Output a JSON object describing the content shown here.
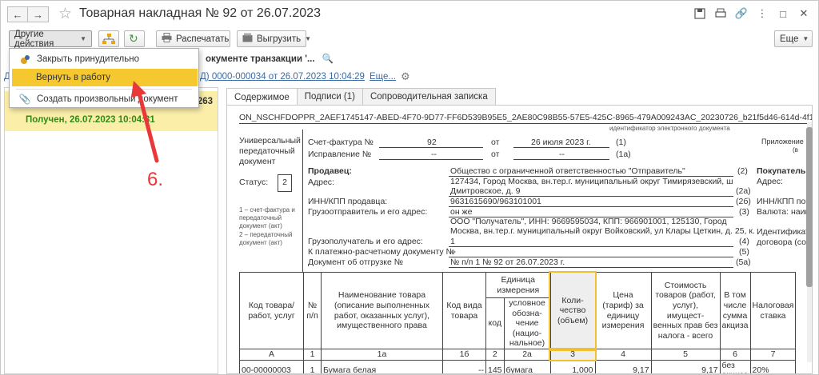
{
  "window": {
    "title": "Товарная накладная № 92 от 26.07.2023"
  },
  "toolbar": {
    "other_actions": "Другие действия",
    "print": "Распечатать",
    "export": "Выгрузить",
    "more": "Еще"
  },
  "menu": {
    "items": [
      {
        "label": "Закрыть принудительно",
        "icon": "force-close-icon"
      },
      {
        "label": "Вернуть в работу",
        "icon": "",
        "highlighted": true
      },
      {
        "label": "Создать произвольный документ",
        "icon": "paperclip-icon"
      }
    ]
  },
  "info": {
    "transaction_line": "окументе транзакции '...",
    "doc_link": "Д) 0000-000034 от 26.07.2023 10:04:29",
    "more_link": "Еще...",
    "left_fragment": "Д"
  },
  "left_panel": {
    "number_fragment": "263",
    "status": "Получен, 26.07.2023 10:04:31"
  },
  "tabs": [
    {
      "label": "Содержимое",
      "active": true
    },
    {
      "label": "Подписи (1)",
      "active": false
    },
    {
      "label": "Сопроводительная записка",
      "active": false
    }
  ],
  "document": {
    "file_id": "ON_NSCHFDOPPR_2AEF1745147-ABED-4F70-9D77-FF6D539B95E5_2AE80C98B55-57E5-425C-8965-479A009243AC_20230726_b21f5d46-614d-4f18-9c9d-(",
    "file_id_caption": "идентификатор электронного документа",
    "upd_title": "Универсальный передаточный документ",
    "status_label": "Статус:",
    "status_value": "2",
    "status_note_1": "1 – счет-фактура и передаточный документ (акт)",
    "status_note_2": "2 – передаточный документ (акт)",
    "invoice_label": "Счет-фактура №",
    "invoice_no": "92",
    "from_word": "от",
    "invoice_date": "26 июля 2023 г.",
    "invoice_ref": "(1)",
    "correction_label": "Исправление №",
    "correction_no": "--",
    "correction_from": "от",
    "correction_date": "--",
    "correction_ref": "(1а)",
    "appendix": "Приложение",
    "appendix_sub": "(в",
    "seller_label": "Продавец:",
    "seller_value": "Общество с ограниченной ответственностью \"Отправитель\"",
    "seller_ref": "(2)",
    "buyer_label": "Покупатель:",
    "address_label": "Адрес:",
    "address_value_1": "127434, Город Москва, вн.тер.г. муниципальный округ Тимирязевский, ш",
    "address_value_2": "Дмитровское, д. 9",
    "address_ref": "(2а)",
    "buyer_address": "Адрес:",
    "inn_label": "ИНН/КПП продавца:",
    "inn_value": "9631615690/963101001",
    "inn_ref": "(2б)",
    "buyer_inn": "ИНН/КПП пок",
    "shipper_label": "Грузоотправитель и его адрес:",
    "shipper_value": "он же",
    "shipper_ref": "(3)",
    "currency": "Валюта: наим",
    "consignee_value_1": "ООО \"Получатель\", ИНН: 9669595034, КПП: 966901001, 125130, Город",
    "consignee_value_2": "Москва, вн.тер.г. муниципальный округ Войковский, ул Клары Цеткин, д. 25, к.",
    "consignee_label": "Грузополучатель и его адрес:",
    "consignee_num": "1",
    "consignee_ref": "(4)",
    "identifier": "Идентификат",
    "contract": "договора (сог",
    "payment_label": "К платежно-расчетному документу №",
    "payment_value": "--",
    "payment_ref": "(5)",
    "shipment_label": "Документ об отгрузке №",
    "shipment_value": "№ п/п 1 № 92 от 26.07.2023 г.",
    "shipment_ref": "(5а)"
  },
  "table": {
    "headers": {
      "code": "Код товара/ работ, услуг",
      "num": "№ п/п",
      "name": "Наименование товара (описание выполненных работ, оказанных услуг), имущественного права",
      "kind": "Код вида товара",
      "unit": "Единица измерения",
      "unit_code": "код",
      "unit_name": "условное обозна-чение (нацио-нальное)",
      "qty": "Коли-чество (объем)",
      "price": "Цена (тариф) за единицу измерения",
      "cost": "Стоимость товаров (работ, услуг), имущест-венных прав без налога - всего",
      "excise": "В том числе сумма акциза",
      "tax": "Налоговая ставка"
    },
    "index_row": [
      "А",
      "1",
      "1а",
      "1б",
      "2",
      "2а",
      "3",
      "4",
      "5",
      "6",
      "7"
    ],
    "rows": [
      [
        "00-00000003",
        "1",
        "Бумага белая",
        "--",
        "145",
        "бумага",
        "1,000",
        "9,17",
        "9,17",
        "без акциза",
        "20%"
      ]
    ]
  },
  "annotation": {
    "step": "6."
  },
  "colors": {
    "highlight": "#f6c82f",
    "status_green": "#2e8b16",
    "link": "#3d6aa0",
    "arrow": "#e8383a"
  }
}
